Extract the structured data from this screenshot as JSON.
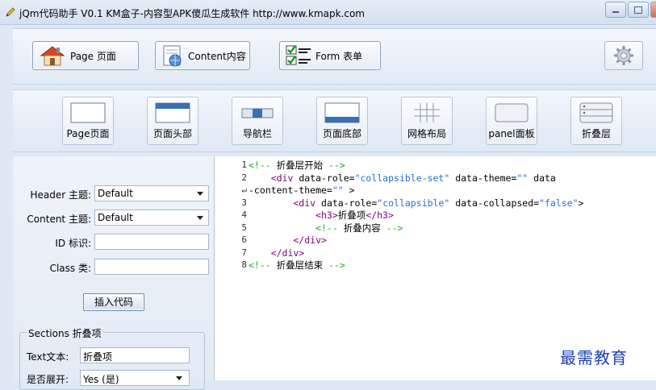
{
  "window": {
    "title": "jQm代码助手 V0.1  KM盒子-内容型APK傻瓜生成软件 http://www.kmapk.com"
  },
  "toolbar_main": {
    "page_label": "Page 页面",
    "content_label": "Content内容",
    "form_label": "Form 表单"
  },
  "components": [
    {
      "label": "Page页面"
    },
    {
      "label": "页面头部"
    },
    {
      "label": "导航栏"
    },
    {
      "label": "页面底部"
    },
    {
      "label": "网格布局"
    },
    {
      "label": "panel面板"
    },
    {
      "label": "折叠层"
    }
  ],
  "form": {
    "header_theme_label": "Header 主题:",
    "header_theme_value": "Default",
    "content_theme_label": "Content 主题:",
    "content_theme_value": "Default",
    "id_label": "ID 标识:",
    "id_value": "",
    "class_label": "Class 类:",
    "class_value": "",
    "insert_button": "插入代码"
  },
  "sections": {
    "title": "Sections 折叠项",
    "text_label": "Text文本:",
    "text_value": "折叠项",
    "expand_label": "是否展开:",
    "expand_value": "Yes (是)"
  },
  "code": {
    "lines": [
      {
        "n": "1",
        "tokens": [
          {
            "c": "cmt",
            "t": "<!-- "
          },
          {
            "c": "chn",
            "t": "折叠层开始"
          },
          {
            "c": "cmt",
            "t": " -->"
          }
        ]
      },
      {
        "n": "2",
        "tokens": [
          {
            "c": "tag",
            "t": "    <div"
          },
          {
            "c": "attr",
            "t": " data-role="
          },
          {
            "c": "str",
            "t": "\"collapsible-set\""
          },
          {
            "c": "attr",
            "t": " data-theme="
          },
          {
            "c": "str",
            "t": "\"\""
          },
          {
            "c": "attr",
            "t": " data"
          }
        ]
      },
      {
        "n": "↵",
        "tokens": [
          {
            "c": "attr",
            "t": "-content-theme="
          },
          {
            "c": "str",
            "t": "\"\""
          },
          {
            "c": "attr",
            "t": " >"
          }
        ]
      },
      {
        "n": "3",
        "tokens": [
          {
            "c": "tag",
            "t": "        <div"
          },
          {
            "c": "attr",
            "t": " data-role="
          },
          {
            "c": "str",
            "t": "\"collapsible\""
          },
          {
            "c": "attr",
            "t": " data-collapsed="
          },
          {
            "c": "str",
            "t": "\"false\""
          },
          {
            "c": "attr",
            "t": ">"
          }
        ]
      },
      {
        "n": "4",
        "tokens": [
          {
            "c": "tag",
            "t": "            <h3>"
          },
          {
            "c": "chn",
            "t": "折叠项"
          },
          {
            "c": "tag",
            "t": "</h3>"
          }
        ]
      },
      {
        "n": "5",
        "tokens": [
          {
            "c": "cmt",
            "t": "            <!-- "
          },
          {
            "c": "chn",
            "t": "折叠内容"
          },
          {
            "c": "cmt",
            "t": " -->"
          }
        ]
      },
      {
        "n": "6",
        "tokens": [
          {
            "c": "tag",
            "t": "        </div>"
          }
        ]
      },
      {
        "n": "7",
        "tokens": [
          {
            "c": "tag",
            "t": "    </div>"
          }
        ]
      },
      {
        "n": "8",
        "tokens": [
          {
            "c": "cmt",
            "t": "<!-- "
          },
          {
            "c": "chn",
            "t": "折叠层结束"
          },
          {
            "c": "cmt",
            "t": " -->"
          }
        ]
      }
    ]
  },
  "watermark": "最需教育",
  "colors": {
    "comment": "#22aa22",
    "tag": "#7a007a",
    "string": "#2a6fc9",
    "watermark": "#1a3fb0"
  }
}
